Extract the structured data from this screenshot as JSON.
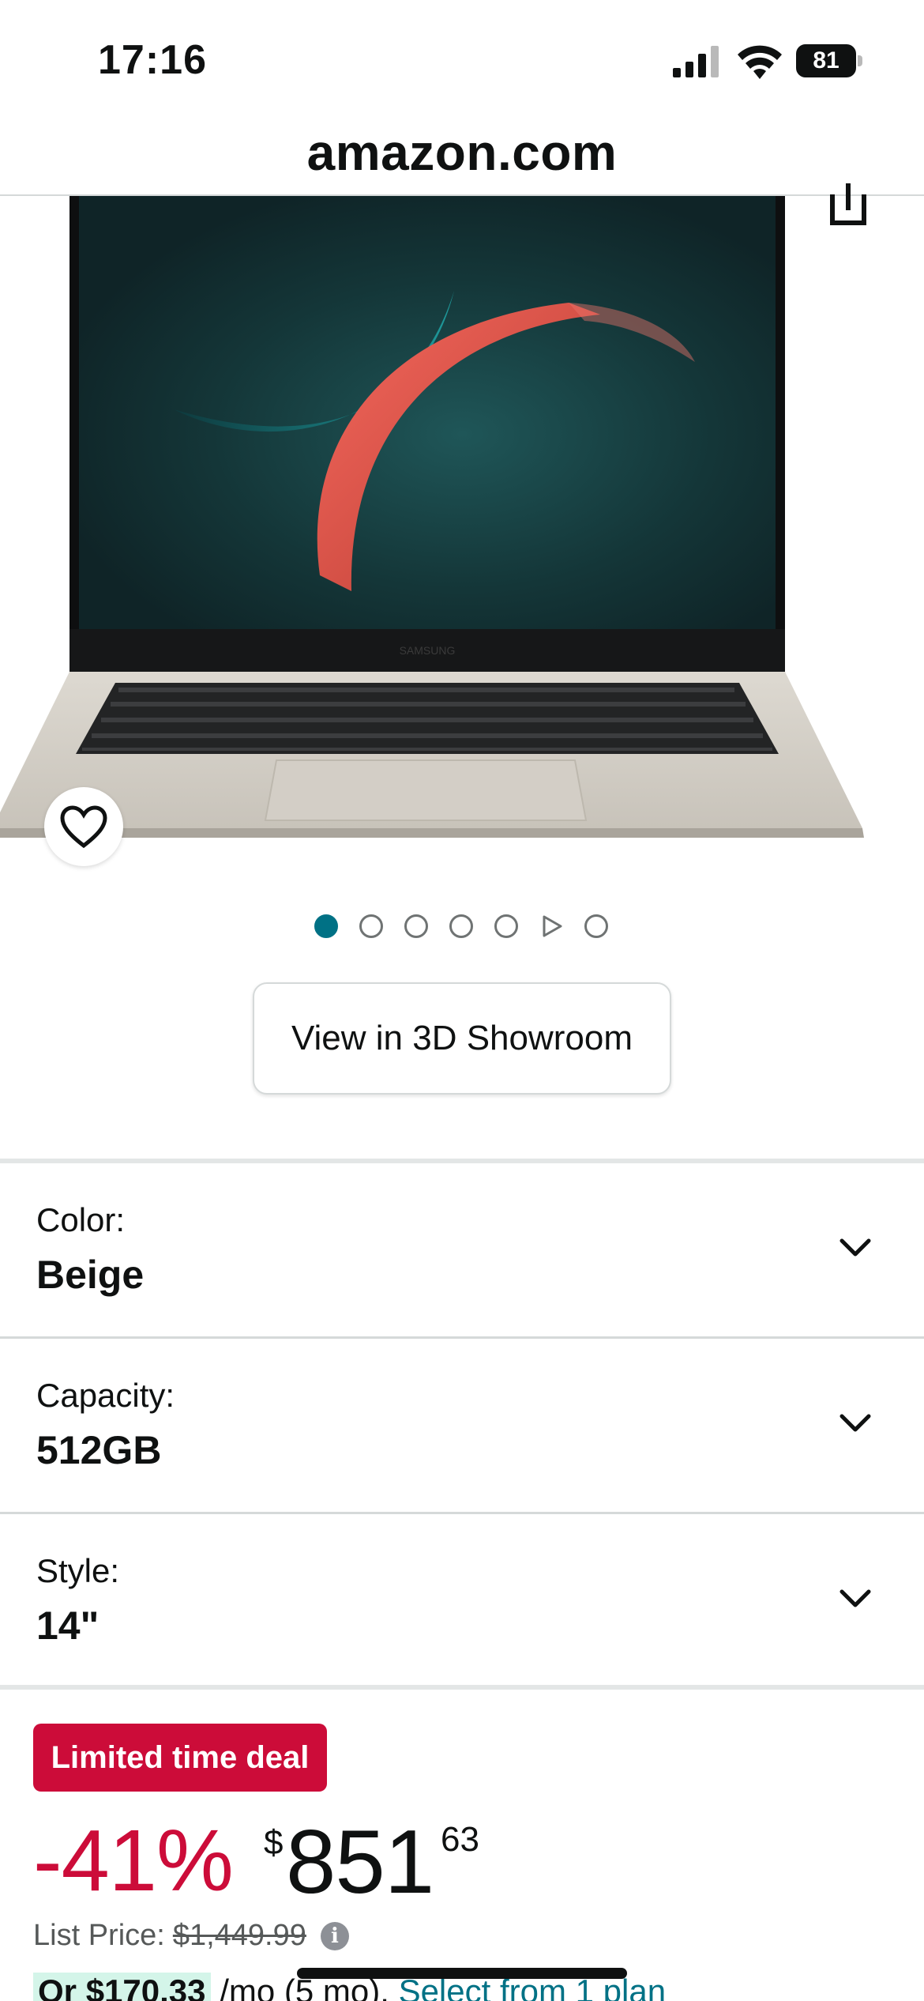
{
  "status_bar": {
    "time": "17:16",
    "battery_level": "81"
  },
  "browser": {
    "domain": "amazon.com"
  },
  "gallery": {
    "image_count": 7,
    "active_index": 0,
    "video_index": 5,
    "showroom_label": "View in 3D Showroom"
  },
  "selectors": [
    {
      "label": "Color:",
      "value": "Beige"
    },
    {
      "label": "Capacity:",
      "value": "512GB"
    },
    {
      "label": "Style:",
      "value": "14\""
    }
  ],
  "deal": {
    "badge": "Limited time deal",
    "discount": "-41%",
    "currency_symbol": "$",
    "price_whole": "851",
    "price_fraction": "63",
    "list_price_label": "List Price:",
    "list_price": "$1,449.99"
  },
  "installment": {
    "prefix": "Or",
    "amount": "$170.33",
    "term": "/mo (5 mo).",
    "link": "Select from 1 plan"
  },
  "colors": {
    "deal_red": "#cc0c39",
    "link_teal": "#007185",
    "text": "#0f1111"
  }
}
